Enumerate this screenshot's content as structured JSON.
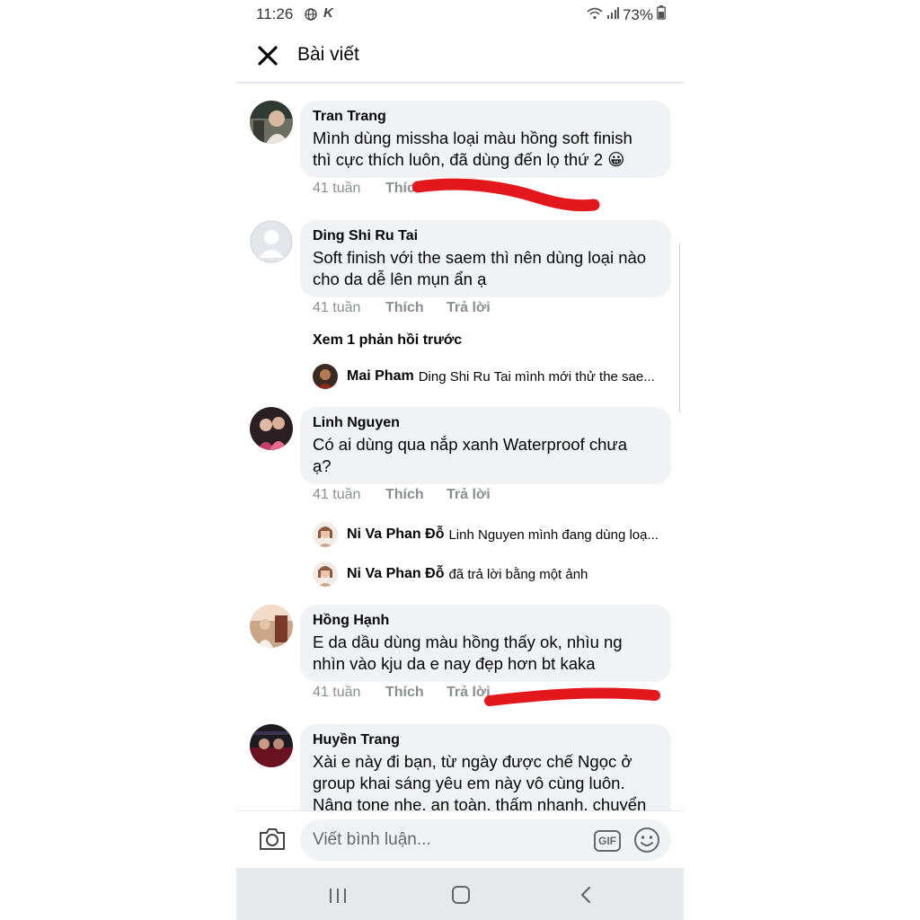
{
  "status_bar": {
    "time": "11:26",
    "battery": "73%",
    "icons": [
      "globe-icon",
      "k-app-icon",
      "wifi-icon",
      "signal-icon",
      "battery-icon"
    ]
  },
  "header": {
    "title": "Bài viết",
    "close_icon": "close-icon"
  },
  "comments": [
    {
      "author": "Tran Trang",
      "lines": [
        "Mình dùng missha loại màu hồng soft finish",
        "thì cực thích luôn, đã dùng đến lọ thứ 2 😀"
      ],
      "time": "41 tuần",
      "like": "Thíc",
      "reply": ""
    },
    {
      "author": "Ding Shi Ru Tai",
      "lines": [
        "Soft finish với the saem thì nên dùng loại nào",
        "cho da dễ lên mụn ẩn ạ"
      ],
      "time": "41 tuần",
      "like": "Thích",
      "reply": "Trả lời",
      "more_replies": "Xem 1 phản hồi trước",
      "replies": [
        {
          "author": "Mai Pham",
          "text": "Ding Shi Ru Tai mình mới thử the sae..."
        }
      ]
    },
    {
      "author": "Linh Nguyen",
      "lines": [
        "Có ai dùng qua nắp xanh Waterproof chưa",
        "ạ?"
      ],
      "time": "41 tuần",
      "like": "Thích",
      "reply": "Trả lời",
      "replies": [
        {
          "author": "Ni Va Phan Đỗ",
          "text": "Linh Nguyen mình đang dùng loạ..."
        },
        {
          "author": "Ni Va Phan Đỗ",
          "text": "đã trả lời bằng một ảnh"
        }
      ]
    },
    {
      "author": "Hồng Hạnh",
      "lines": [
        "E da dầu dùng màu hồng thấy ok, nhìu ng",
        "nhìn vào kju da e nay đẹp hơn bt kaka"
      ],
      "time": "41 tuần",
      "like": "Thích",
      "reply": "Trả lời"
    },
    {
      "author": "Huyền Trang",
      "lines": [
        "Xài e này đi bạn, từ ngày được chế Ngọc ở",
        "group khai sáng yêu em này vô cùng luôn.",
        "Nâng tone nhẹ, an toàn, thấm nhanh, chuyển"
      ]
    }
  ],
  "composer": {
    "placeholder": "Viết bình luận...",
    "gif_label": "GIF",
    "icons": [
      "camera-icon",
      "gif-icon",
      "emoji-icon"
    ]
  },
  "navbar": {
    "icons": [
      "recent-apps-icon",
      "home-icon",
      "back-icon"
    ]
  },
  "colors": {
    "bubble": "#f0f2f5",
    "meta_text": "#8a8d91",
    "annotation_red": "#e3181d"
  }
}
